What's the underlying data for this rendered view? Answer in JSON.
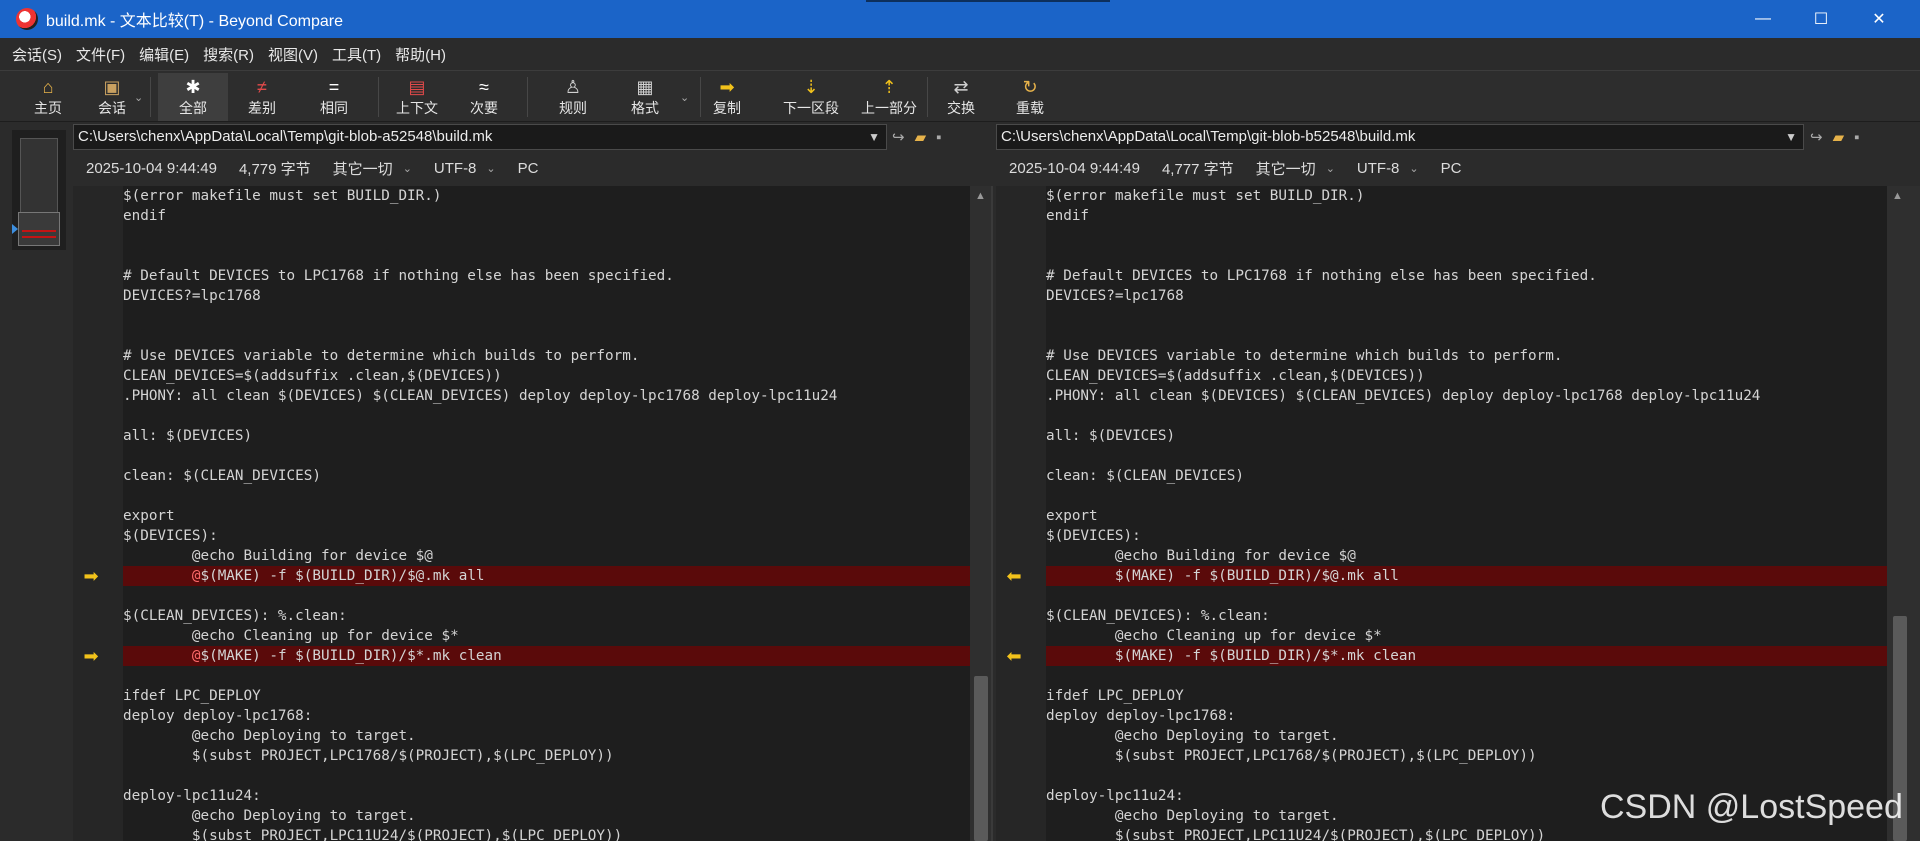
{
  "window": {
    "title": "build.mk - 文本比较(T) - Beyond Compare",
    "minimize": "—",
    "maximize": "☐",
    "close": "✕"
  },
  "menu": [
    "会话(S)",
    "文件(F)",
    "编辑(E)",
    "搜索(R)",
    "视图(V)",
    "工具(T)",
    "帮助(H)"
  ],
  "toolbar": [
    {
      "label": "主页",
      "icon": "home-icon",
      "glyph": "⌂",
      "color": "#e6b24a"
    },
    {
      "label": "会话",
      "icon": "briefcase-icon",
      "glyph": "▣",
      "color": "#c8a060"
    },
    {
      "label": "全部",
      "icon": "asterisk-icon",
      "glyph": "✱",
      "color": "#ffffff"
    },
    {
      "label": "差别",
      "icon": "not-equal-icon",
      "glyph": "≠",
      "color": "#e24a4a"
    },
    {
      "label": "相同",
      "icon": "equal-icon",
      "glyph": "=",
      "color": "#ffffff"
    },
    {
      "label": "上下文",
      "icon": "context-icon",
      "glyph": "▤",
      "color": "#e24a4a"
    },
    {
      "label": "次要",
      "icon": "approx-icon",
      "glyph": "≈",
      "color": "#ffffff"
    },
    {
      "label": "规则",
      "icon": "referee-icon",
      "glyph": "♙",
      "color": "#d0d0d0"
    },
    {
      "label": "格式",
      "icon": "format-icon",
      "glyph": "▦",
      "color": "#d0d0d0"
    },
    {
      "label": "复制",
      "icon": "copy-arrow-icon",
      "glyph": "➡",
      "color": "#f2c21b"
    },
    {
      "label": "下一区段",
      "icon": "next-section-icon",
      "glyph": "⇣",
      "color": "#f2c21b"
    },
    {
      "label": "上一部分",
      "icon": "prev-section-icon",
      "glyph": "⇡",
      "color": "#f2c21b"
    },
    {
      "label": "交换",
      "icon": "swap-icon",
      "glyph": "⇄",
      "color": "#d0d0d0"
    },
    {
      "label": "重载",
      "icon": "reload-icon",
      "glyph": "↻",
      "color": "#e6b24a"
    }
  ],
  "left": {
    "path": "C:\\Users\\chenx\\AppData\\Local\\Temp\\git-blob-a52548\\build.mk",
    "date": "2025-10-04 9:44:49",
    "size": "4,779 字节",
    "mode": "其它一切",
    "encoding": "UTF-8",
    "lineending": "PC"
  },
  "right": {
    "path": "C:\\Users\\chenx\\AppData\\Local\\Temp\\git-blob-b52548\\build.mk",
    "date": "2025-10-04 9:44:49",
    "size": "4,777 字节",
    "mode": "其它一切",
    "encoding": "UTF-8",
    "lineending": "PC"
  },
  "code_left": [
    {
      "t": "$(error makefile must set BUILD_DIR.)"
    },
    {
      "t": "endif"
    },
    {
      "t": ""
    },
    {
      "t": ""
    },
    {
      "t": "# Default DEVICES to LPC1768 if nothing else has been specified."
    },
    {
      "t": "DEVICES?=lpc1768"
    },
    {
      "t": ""
    },
    {
      "t": ""
    },
    {
      "t": "# Use DEVICES variable to determine which builds to perform."
    },
    {
      "t": "CLEAN_DEVICES=$(addsuffix .clean,$(DEVICES))"
    },
    {
      "t": ".PHONY: all clean $(DEVICES) $(CLEAN_DEVICES) deploy deploy-lpc1768 deploy-lpc11u24"
    },
    {
      "t": ""
    },
    {
      "t": "all: $(DEVICES)"
    },
    {
      "t": ""
    },
    {
      "t": "clean: $(CLEAN_DEVICES)"
    },
    {
      "t": ""
    },
    {
      "t": "export"
    },
    {
      "t": "$(DEVICES):"
    },
    {
      "t": "        @echo Building for device $@"
    },
    {
      "t": "        @$(MAKE) -f $(BUILD_DIR)/$@.mk all",
      "diff": true,
      "hl": "@"
    },
    {
      "t": ""
    },
    {
      "t": "$(CLEAN_DEVICES): %.clean:"
    },
    {
      "t": "        @echo Cleaning up for device $*"
    },
    {
      "t": "        @$(MAKE) -f $(BUILD_DIR)/$*.mk clean",
      "diff": true,
      "hl": "@"
    },
    {
      "t": ""
    },
    {
      "t": "ifdef LPC_DEPLOY"
    },
    {
      "t": "deploy deploy-lpc1768:"
    },
    {
      "t": "        @echo Deploying to target."
    },
    {
      "t": "        $(subst PROJECT,LPC1768/$(PROJECT),$(LPC_DEPLOY))"
    },
    {
      "t": ""
    },
    {
      "t": "deploy-lpc11u24:"
    },
    {
      "t": "        @echo Deploying to target."
    },
    {
      "t": "        $(subst PROJECT,LPC11U24/$(PROJECT),$(LPC_DEPLOY))"
    }
  ],
  "code_right": [
    {
      "t": "$(error makefile must set BUILD_DIR.)"
    },
    {
      "t": "endif"
    },
    {
      "t": ""
    },
    {
      "t": ""
    },
    {
      "t": "# Default DEVICES to LPC1768 if nothing else has been specified."
    },
    {
      "t": "DEVICES?=lpc1768"
    },
    {
      "t": ""
    },
    {
      "t": ""
    },
    {
      "t": "# Use DEVICES variable to determine which builds to perform."
    },
    {
      "t": "CLEAN_DEVICES=$(addsuffix .clean,$(DEVICES))"
    },
    {
      "t": ".PHONY: all clean $(DEVICES) $(CLEAN_DEVICES) deploy deploy-lpc1768 deploy-lpc11u24"
    },
    {
      "t": ""
    },
    {
      "t": "all: $(DEVICES)"
    },
    {
      "t": ""
    },
    {
      "t": "clean: $(CLEAN_DEVICES)"
    },
    {
      "t": ""
    },
    {
      "t": "export"
    },
    {
      "t": "$(DEVICES):"
    },
    {
      "t": "        @echo Building for device $@"
    },
    {
      "t": "        $(MAKE) -f $(BUILD_DIR)/$@.mk all",
      "diff": true
    },
    {
      "t": ""
    },
    {
      "t": "$(CLEAN_DEVICES): %.clean:"
    },
    {
      "t": "        @echo Cleaning up for device $*"
    },
    {
      "t": "        $(MAKE) -f $(BUILD_DIR)/$*.mk clean",
      "diff": true
    },
    {
      "t": ""
    },
    {
      "t": "ifdef LPC_DEPLOY"
    },
    {
      "t": "deploy deploy-lpc1768:"
    },
    {
      "t": "        @echo Deploying to target."
    },
    {
      "t": "        $(subst PROJECT,LPC1768/$(PROJECT),$(LPC_DEPLOY))"
    },
    {
      "t": ""
    },
    {
      "t": "deploy-lpc11u24:"
    },
    {
      "t": "        @echo Deploying to target."
    },
    {
      "t": "        $(subst PROJECT,LPC11U24/$(PROJECT),$(LPC_DEPLOY))"
    }
  ],
  "watermark": "CSDN @LostSpeed",
  "colors": {
    "titlebar": "#1b64c8",
    "diff_row": "#5a0a0a",
    "diff_text": "#ff6b6b",
    "arrow": "#f2c21b"
  }
}
